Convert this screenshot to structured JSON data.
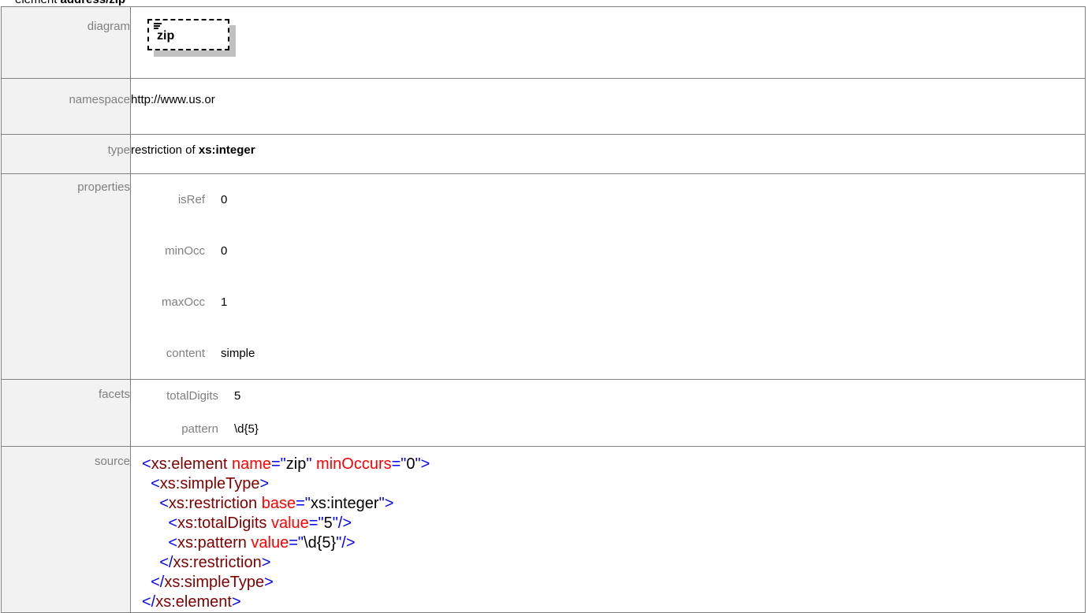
{
  "title": {
    "prefix": "element",
    "name": "address/zip"
  },
  "labels": {
    "diagram": "diagram",
    "namespace": "namespace",
    "type": "type",
    "properties": "properties",
    "facets": "facets",
    "source": "source"
  },
  "diagram": {
    "element_name": "zip",
    "icon": "element-content-icon"
  },
  "namespace": "http://www.us.or",
  "type": {
    "prefix": "restriction of",
    "base": "xs:integer"
  },
  "properties": [
    {
      "key": "isRef",
      "value": "0"
    },
    {
      "key": "minOcc",
      "value": "0"
    },
    {
      "key": "maxOcc",
      "value": "1"
    },
    {
      "key": "content",
      "value": "simple"
    }
  ],
  "facets": [
    {
      "key": "totalDigits",
      "value": "5"
    },
    {
      "key": "pattern",
      "value": "\\d{5}"
    }
  ],
  "source": {
    "open_element": "xs:element",
    "attr_name": "name",
    "attr_name_val": "zip",
    "attr_minOccurs": "minOccurs",
    "attr_minOccurs_val": "0",
    "simpleType": "xs:simpleType",
    "restriction": "xs:restriction",
    "attr_base": "base",
    "attr_base_val": "xs:integer",
    "totalDigits": "xs:totalDigits",
    "attr_value": "value",
    "totalDigits_val": "5",
    "pattern": "xs:pattern",
    "pattern_val": "\\d{5}"
  },
  "colors": {
    "tag": "#0000ff",
    "element_name": "#800000",
    "attribute": "#ff0000",
    "label_text": "#808080",
    "label_bg": "#f2f2f2"
  }
}
